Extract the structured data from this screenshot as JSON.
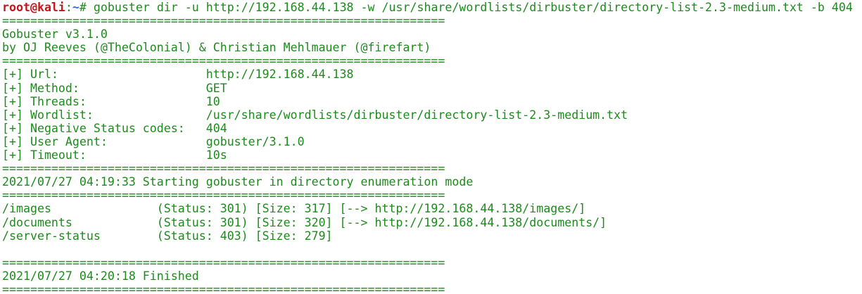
{
  "prompt": {
    "user_host": "root@kali",
    "sep": ":",
    "path": "~",
    "symbol": "# "
  },
  "command": "gobuster dir -u http://192.168.44.138 -w /usr/share/wordlists/dirbuster/directory-list-2.3-medium.txt -b 404",
  "separator": "===============================================================",
  "banner": {
    "title": "Gobuster v3.1.0",
    "authors": "by OJ Reeves (@TheColonial) & Christian Mehlmauer (@firefart)"
  },
  "config": [
    {
      "text": "[+] Url:                     http://192.168.44.138"
    },
    {
      "text": "[+] Method:                  GET"
    },
    {
      "text": "[+] Threads:                 10"
    },
    {
      "text": "[+] Wordlist:                /usr/share/wordlists/dirbuster/directory-list-2.3-medium.txt"
    },
    {
      "text": "[+] Negative Status codes:   404"
    },
    {
      "text": "[+] User Agent:              gobuster/3.1.0"
    },
    {
      "text": "[+] Timeout:                 10s"
    }
  ],
  "start_message": "2021/07/27 04:19:33 Starting gobuster in directory enumeration mode",
  "results": [
    {
      "text": "/images               (Status: 301) [Size: 317] [--> http://192.168.44.138/images/]"
    },
    {
      "text": "/documents            (Status: 301) [Size: 320] [--> http://192.168.44.138/documents/]"
    },
    {
      "text": "/server-status        (Status: 403) [Size: 279]"
    }
  ],
  "finish_message": "2021/07/27 04:20:18 Finished",
  "colors": {
    "text": "#1e8a1e",
    "prompt_user": "#c4161c",
    "prompt_path": "#2f6fd6",
    "background": "#ffffff"
  }
}
